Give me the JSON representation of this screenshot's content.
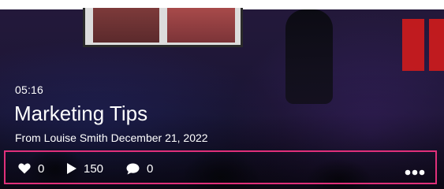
{
  "video": {
    "duration": "05:16",
    "title": "Marketing Tips",
    "from_prefix": "From",
    "author": "Louise Smith",
    "date": "December 21, 2022"
  },
  "stats": {
    "likes": "0",
    "plays": "150",
    "comments": "0"
  },
  "icons": {
    "likes": "heart-icon",
    "plays": "play-icon",
    "comments": "comment-icon",
    "more": "more-options-icon"
  },
  "colors": {
    "highlight_border": "#e0307a",
    "text": "#ffffff"
  }
}
